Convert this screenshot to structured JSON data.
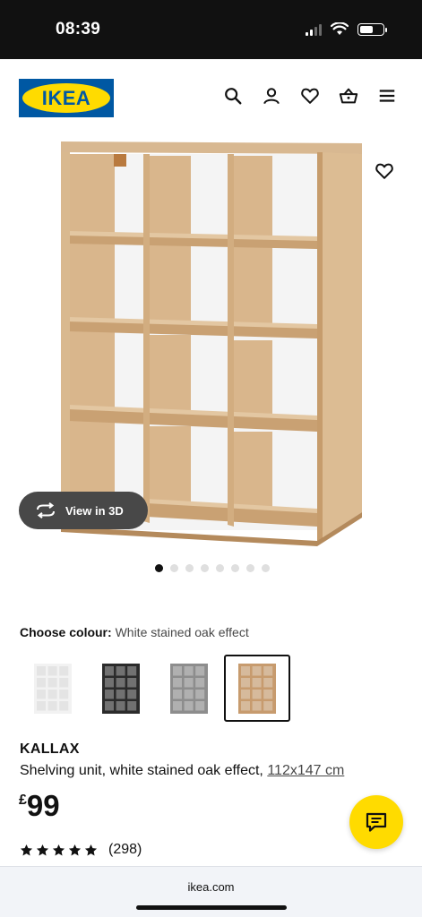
{
  "status_bar": {
    "time": "08:39",
    "battery_level": 0.6
  },
  "header": {
    "logo_text": "IKEA",
    "icons": [
      "search-icon",
      "account-icon",
      "wishlist-icon",
      "basket-icon",
      "menu-icon"
    ]
  },
  "hero": {
    "view_3d_label": "View in 3D",
    "image_count": 8,
    "active_image": 1
  },
  "colour": {
    "label": "Choose colour:",
    "selected_value": "White stained oak effect",
    "options": [
      {
        "name": "white",
        "color": "#f2f2f2"
      },
      {
        "name": "black-brown",
        "color": "#2b2b2b"
      },
      {
        "name": "grey",
        "color": "#8d8d8d"
      },
      {
        "name": "white-stained-oak",
        "color": "#c79b6e"
      }
    ],
    "selected_index": 3
  },
  "product": {
    "name": "KALLAX",
    "description": "Shelving unit, white stained oak effect,",
    "dimensions": "112x147 cm",
    "price_currency": "£",
    "price_amount": "99",
    "rating_stars": 5,
    "review_count": "(298)"
  },
  "browser": {
    "url": "ikea.com"
  },
  "colors": {
    "brand_blue": "#0058a3",
    "brand_yellow": "#ffdb00"
  }
}
